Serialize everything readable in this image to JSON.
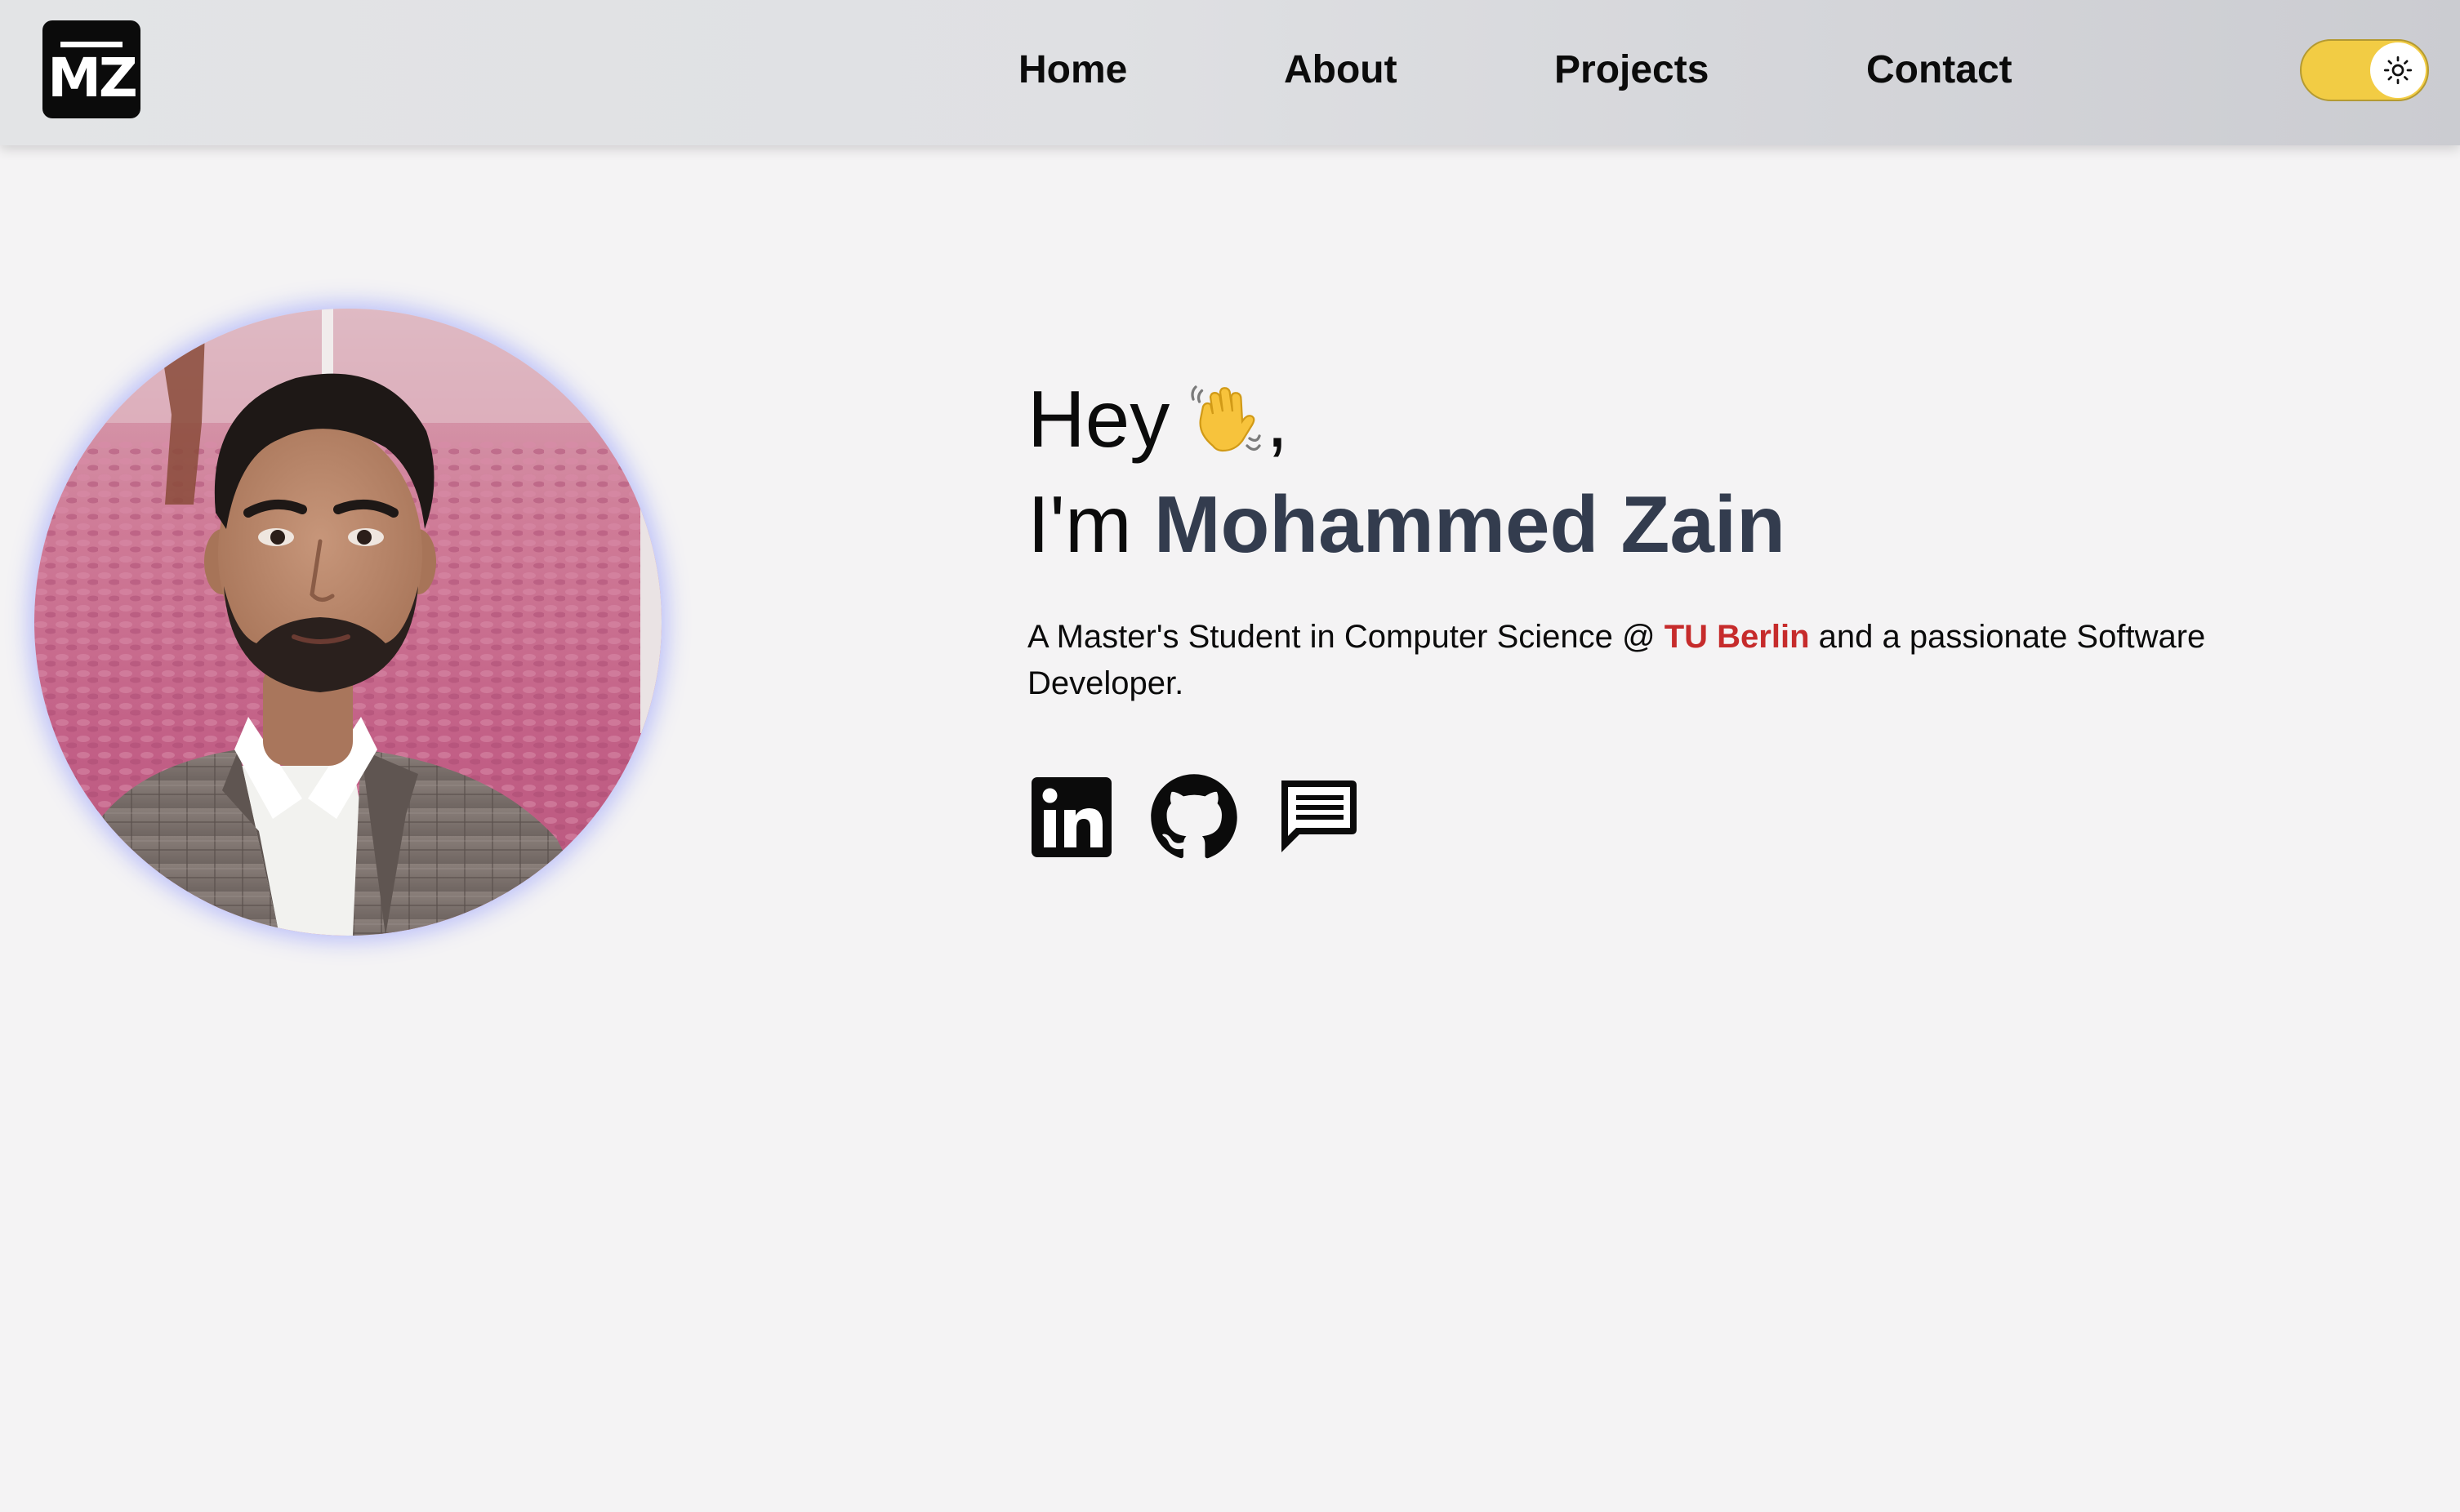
{
  "logo": {
    "text": "MZ"
  },
  "nav": {
    "home": "Home",
    "about": "About",
    "projects": "Projects",
    "contact": "Contact"
  },
  "theme_toggle": {
    "state": "light",
    "icon": "sun-icon",
    "color": "#f2cc44"
  },
  "hero": {
    "greeting": "Hey",
    "greeting_suffix": ",",
    "greeting_emoji": "waving-hand-icon",
    "intro_prefix": "I'm",
    "name": "Mohammed Zain",
    "desc_part1": "A Master's Student in Computer Science @ ",
    "desc_university": "TU Berlin",
    "desc_part2": " and a passionate Software Developer."
  },
  "social_links": [
    "linkedin-icon",
    "github-icon",
    "message-icon"
  ],
  "colors": {
    "name": "#333c4e",
    "university": "#c62b2b",
    "background": "#f4f3f4"
  }
}
